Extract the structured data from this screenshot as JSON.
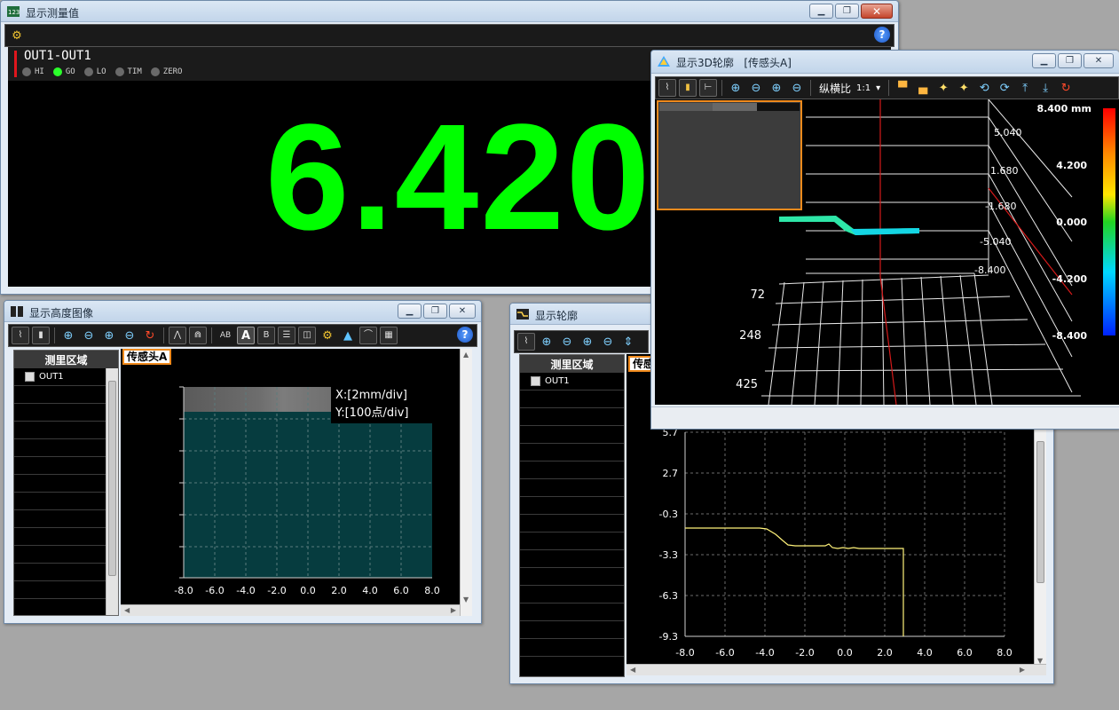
{
  "measure_window": {
    "title": "显示测量值",
    "output_name": "OUT1-OUT1",
    "value": "6.420",
    "leds": [
      {
        "label": "HI",
        "on": false
      },
      {
        "label": "GO",
        "on": true
      },
      {
        "label": "LO",
        "on": false
      },
      {
        "label": "TIM",
        "on": false
      },
      {
        "label": "ZERO",
        "on": false
      }
    ],
    "colors": {
      "value": "#00ff00",
      "go_led": "#2bff2b",
      "judge_bar": "#e0161d"
    }
  },
  "height_window": {
    "title": "显示高度图像",
    "toolbar_icons": [
      "graph-icon",
      "color-bar-icon",
      "zoom-in-vertical-icon",
      "zoom-out-vertical-icon",
      "zoom-in-horizontal-icon",
      "zoom-out-horizontal-icon",
      "reset-icon",
      "peak-icon",
      "peak-range-icon",
      "text-ab-icon",
      "display-a-icon",
      "display-b-icon",
      "layout-horizontal-icon",
      "layout-vertical-icon",
      "settings-icon",
      "3d-icon",
      "profile-icon",
      "calculator-icon",
      "help-icon"
    ],
    "list_header": "测里区域",
    "list_items": [
      "OUT1"
    ],
    "sensor_tag": "传感头A",
    "x_scale": "X:[2mm/div]",
    "y_scale": "Y:[100点/div]",
    "x_ticks": [
      "-8.0",
      "-6.0",
      "-4.0",
      "-2.0",
      "0.0",
      "2.0",
      "4.0",
      "6.0",
      "8.0"
    ]
  },
  "profile_window": {
    "title": "显示轮廓",
    "list_header": "测里区域",
    "list_items": [
      "OUT1"
    ],
    "sensor_tag": "传感",
    "y_ticks": [
      "5.7",
      "2.7",
      "-0.3",
      "-3.3",
      "-6.3",
      "-9.3"
    ],
    "x_ticks": [
      "-8.0",
      "-6.0",
      "-4.0",
      "-2.0",
      "0.0",
      "2.0",
      "4.0",
      "6.0",
      "8.0"
    ]
  },
  "window_3d": {
    "title": "显示3D轮廓",
    "subtitle": "[传感头A]",
    "aspect_label": "纵横比",
    "aspect_value": "1:1",
    "axis_labels": [
      "5.040",
      "1.680",
      "-1.680",
      "-5.040",
      "-8.400"
    ],
    "row_labels": [
      "72",
      "248",
      "425"
    ],
    "colorbar_max": "8.400 mm",
    "colorbar_ticks": [
      "4.200",
      "0.000",
      "-4.200",
      "-8.400"
    ]
  }
}
